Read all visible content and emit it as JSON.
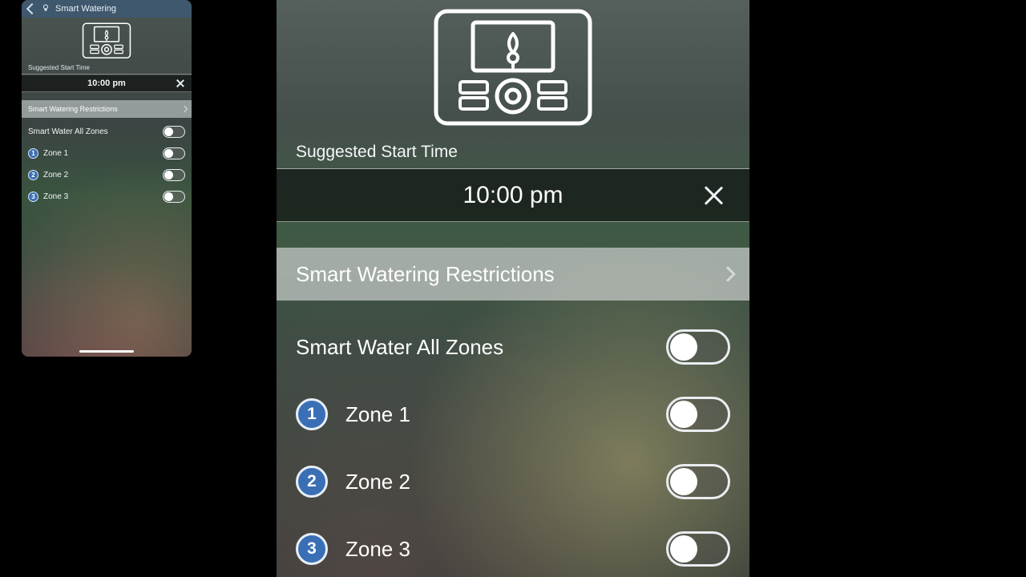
{
  "small": {
    "nav_title": "Smart Watering",
    "suggested_label": "Suggested Start Time",
    "time_value": "10:00 pm",
    "restrictions_label": "Smart Watering Restrictions",
    "all_zones_label": "Smart Water All Zones",
    "zones": [
      {
        "num": "1",
        "label": "Zone 1"
      },
      {
        "num": "2",
        "label": "Zone 2"
      },
      {
        "num": "3",
        "label": "Zone 3"
      }
    ]
  },
  "large": {
    "suggested_label": "Suggested Start Time",
    "time_value": "10:00 pm",
    "restrictions_label": "Smart Watering Restrictions",
    "all_zones_label": "Smart Water All Zones",
    "zones": [
      {
        "num": "1",
        "label": "Zone 1"
      },
      {
        "num": "2",
        "label": "Zone 2"
      },
      {
        "num": "3",
        "label": "Zone 3"
      }
    ]
  }
}
